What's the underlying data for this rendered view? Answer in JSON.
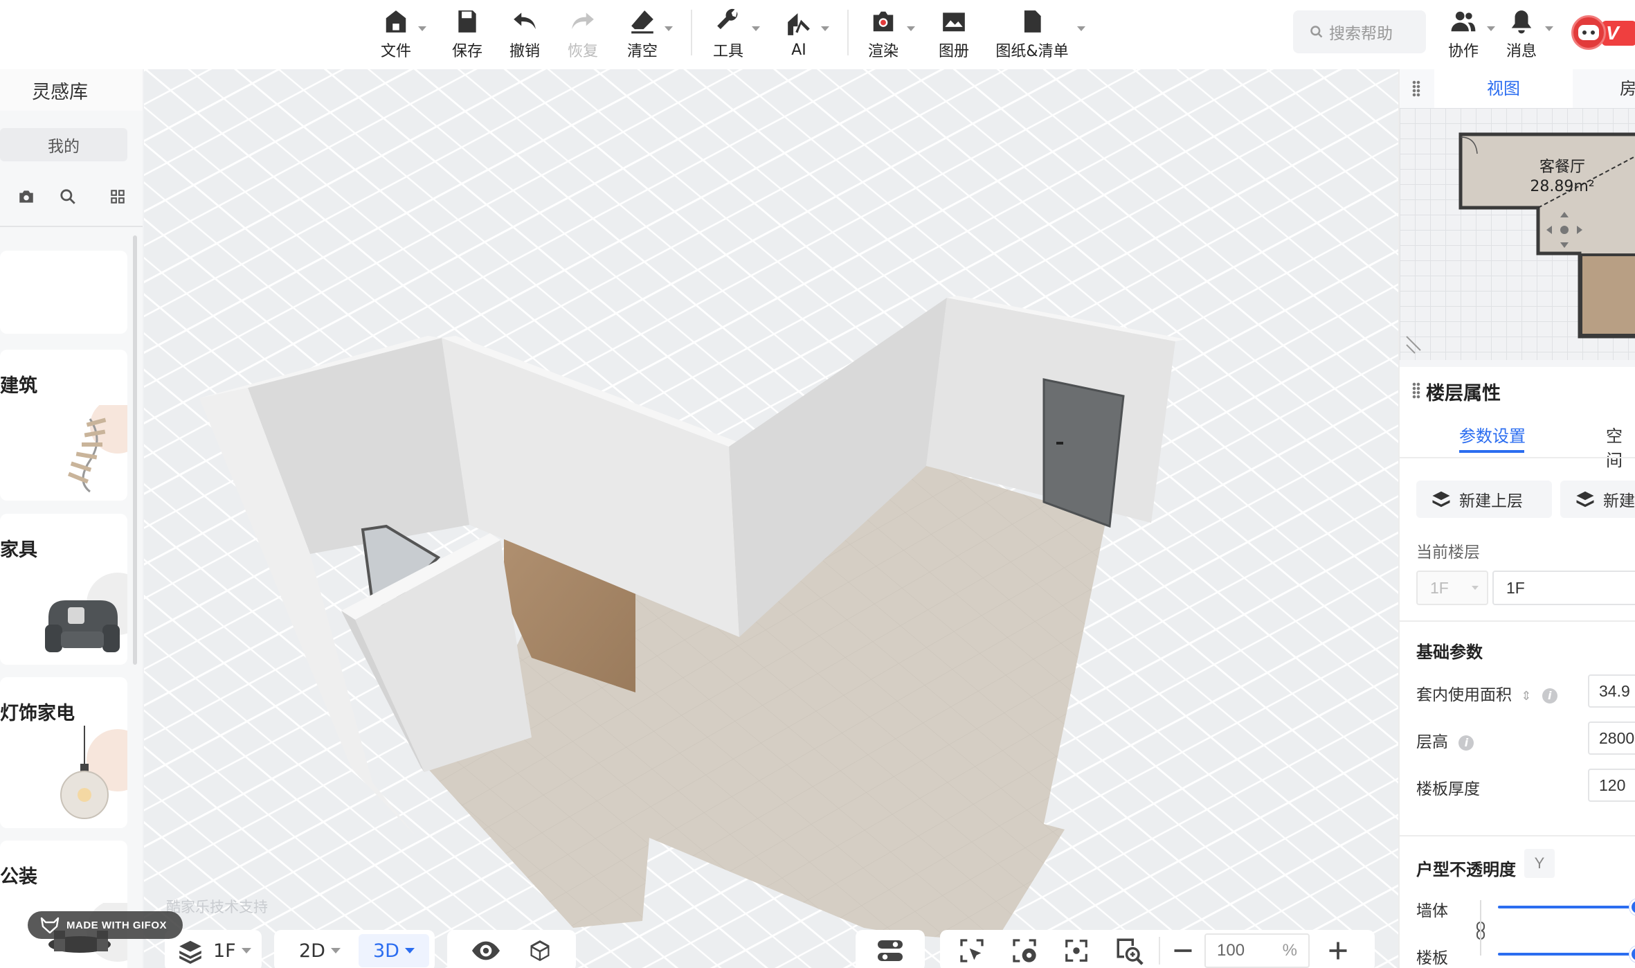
{
  "toolbar": {
    "file": "文件",
    "save": "保存",
    "undo": "撤销",
    "redo": "恢复",
    "clear": "清空",
    "tools": "工具",
    "ai": "AI",
    "render": "渲染",
    "album": "图册",
    "drawings": "图纸&清单",
    "search_placeholder": "搜索帮助",
    "collab": "协作",
    "messages": "消息",
    "vip": "V"
  },
  "left_panel": {
    "title": "灵感库",
    "mine": "我的",
    "categories": [
      "建筑",
      "家具",
      "灯饰家电",
      "公装"
    ]
  },
  "right_panel": {
    "tab_view": "视图",
    "tab_room": "房",
    "minimap_room_name": "客餐厅",
    "minimap_room_area": "28.89m²",
    "floor_props_title": "楼层属性",
    "subtab_params": "参数设置",
    "subtab_space": "空间",
    "new_upper_floor": "新建上层",
    "new_other": "新建",
    "current_floor_label": "当前楼层",
    "current_floor_select": "1F",
    "current_floor_name": "1F",
    "basic_params": "基础参数",
    "inner_area_label": "套内使用面积",
    "inner_area_value": "34.9",
    "floor_height_label": "层高",
    "floor_height_value": "2800",
    "slab_thickness_label": "楼板厚度",
    "slab_thickness_value": "120",
    "opacity_title": "户型不透明度",
    "opacity_badge": "Y",
    "wall_label": "墙体",
    "slab_label": "楼板",
    "wall_opacity": 1.0,
    "slab_opacity": 1.0
  },
  "bottom": {
    "floor": "1F",
    "view_2d": "2D",
    "view_3d": "3D",
    "zoom": "100",
    "zoom_unit": "%"
  },
  "support_text": "酷家乐技术支持",
  "watermark": "MADE WITH GIFOX",
  "colors": {
    "accent": "#2b6df0",
    "vip": "#ef3f3f"
  }
}
